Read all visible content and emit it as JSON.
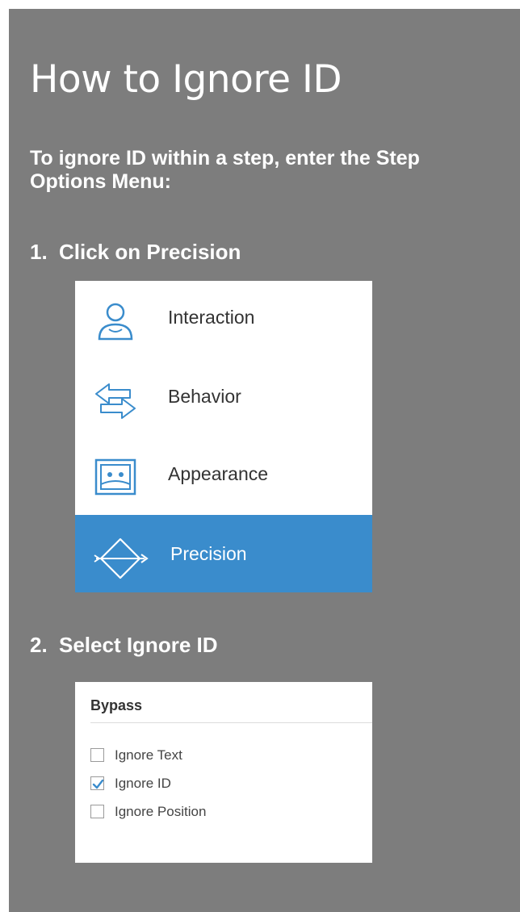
{
  "title": "How to Ignore ID",
  "intro": "To ignore ID within a step, enter the Step Options Menu:",
  "steps": [
    {
      "number": "1.",
      "text": "Click on Precision"
    },
    {
      "number": "2.",
      "text": "Select Ignore ID"
    }
  ],
  "menu": {
    "items": [
      {
        "label": "Interaction",
        "icon": "person-icon",
        "selected": false
      },
      {
        "label": "Behavior",
        "icon": "swap-arrows-icon",
        "selected": false
      },
      {
        "label": "Appearance",
        "icon": "picture-frame-icon",
        "selected": false
      },
      {
        "label": "Precision",
        "icon": "bow-arrow-icon",
        "selected": true
      }
    ]
  },
  "bypass": {
    "title": "Bypass",
    "options": [
      {
        "label": "Ignore Text",
        "checked": false
      },
      {
        "label": "Ignore ID",
        "checked": true
      },
      {
        "label": "Ignore Position",
        "checked": false
      }
    ]
  },
  "colors": {
    "background": "#7d7d7d",
    "selected": "#3a8ccc",
    "icon": "#3a8ccc",
    "check": "#3a8ccc"
  }
}
